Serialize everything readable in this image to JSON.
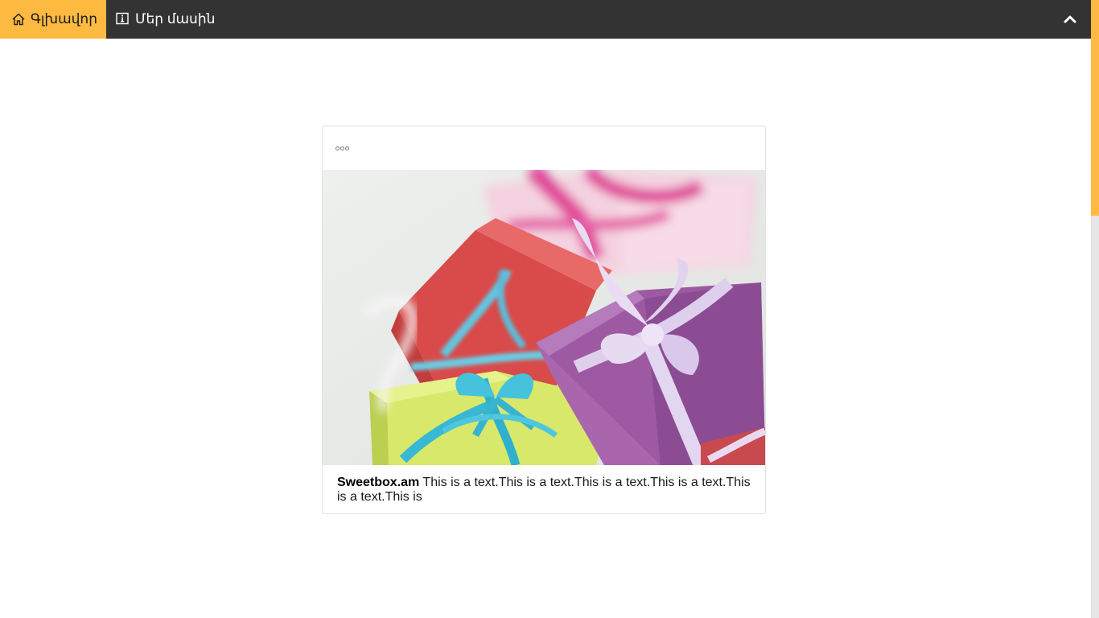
{
  "nav": {
    "home_label": "Գլխավոր",
    "about_label": "Մեր մասին",
    "home_icon": "home-icon",
    "about_icon": "info-icon",
    "collapse_icon": "chevron-up-icon",
    "colors": {
      "bar": "#333333",
      "active": "#fdb940"
    }
  },
  "post": {
    "menu_icon": "more-options-icon",
    "image_alt": "gift-boxes-photo",
    "author": "Sweetbox.am",
    "text": "This is a text.This is a text.This is a text.This is a text.This is a text.This is"
  },
  "scrollbar": {
    "thumb_color": "#fdb940",
    "track_color": "#e6e6e6"
  }
}
